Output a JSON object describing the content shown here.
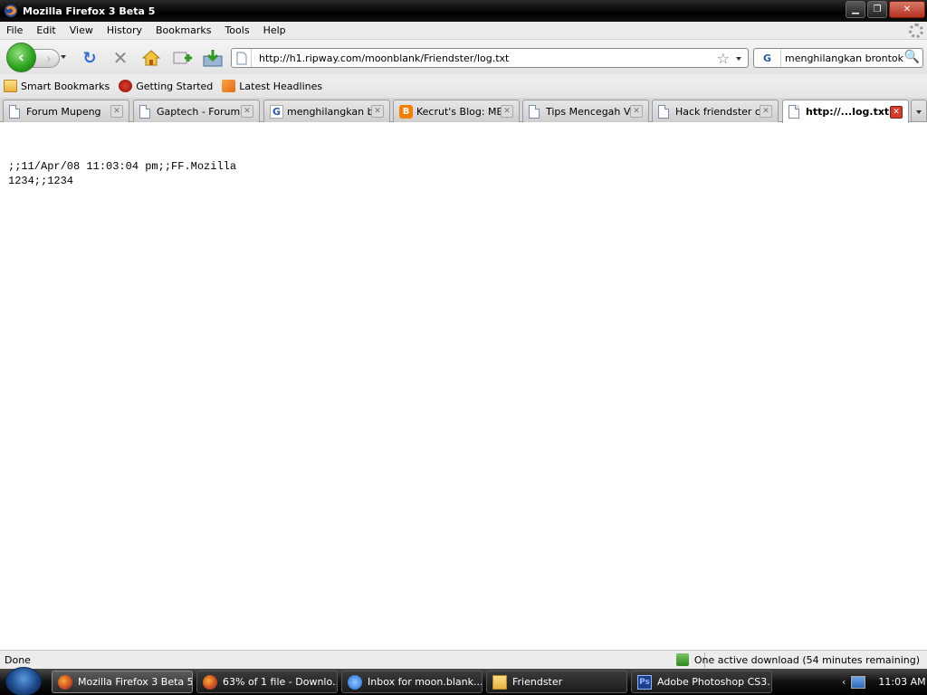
{
  "window": {
    "title": "Mozilla Firefox 3 Beta 5"
  },
  "menu": [
    {
      "label": "File",
      "key": "F"
    },
    {
      "label": "Edit",
      "key": "E"
    },
    {
      "label": "View",
      "key": "V"
    },
    {
      "label": "History",
      "key": "s"
    },
    {
      "label": "Bookmarks",
      "key": "B"
    },
    {
      "label": "Tools",
      "key": "T"
    },
    {
      "label": "Help",
      "key": "H"
    }
  ],
  "nav": {
    "url": "http://h1.ripway.com/moonblank/Friendster/log.txt",
    "search_engine": "G",
    "search_query": "menghilangkan brontok"
  },
  "bookmarks": [
    {
      "label": "Smart Bookmarks",
      "icon": "folder-icon"
    },
    {
      "label": "Getting Started",
      "icon": "getting-started-icon"
    },
    {
      "label": "Latest Headlines",
      "icon": "rss-feed-icon"
    }
  ],
  "tabs": [
    {
      "label": "Forum Mupeng",
      "icon": "page-icon",
      "active": false
    },
    {
      "label": "Gaptech - Forum...",
      "icon": "page-icon",
      "active": false
    },
    {
      "label": "menghilangkan b...",
      "icon": "google-icon",
      "active": false
    },
    {
      "label": "Kecrut's Blog: ME...",
      "icon": "blogger-icon",
      "active": false
    },
    {
      "label": "Tips Mencegah Vi...",
      "icon": "page-icon",
      "active": false
    },
    {
      "label": "Hack friendster c...",
      "icon": "page-icon",
      "active": false
    },
    {
      "label": "http://...log.txt",
      "icon": "page-icon",
      "active": true
    }
  ],
  "content": {
    "line1": ";;11/Apr/08 11:03:04 pm;;FF.Mozilla",
    "line2": "1234;;1234"
  },
  "status": {
    "left": "Done",
    "download": "One active download (54 minutes remaining)"
  },
  "taskbar": {
    "items": [
      {
        "label": "Mozilla Firefox 3 Beta 5",
        "icon": "firefox-icon",
        "active": true
      },
      {
        "label": "63% of 1 file - Downlo...",
        "icon": "firefox-icon",
        "active": false
      },
      {
        "label": "Inbox for moon.blank....",
        "icon": "mail-icon",
        "active": false
      },
      {
        "label": "Friendster",
        "icon": "folder-icon",
        "active": false
      },
      {
        "label": "Adobe Photoshop CS3...",
        "icon": "photoshop-icon",
        "active": false
      }
    ],
    "clock": "11:03 AM"
  }
}
